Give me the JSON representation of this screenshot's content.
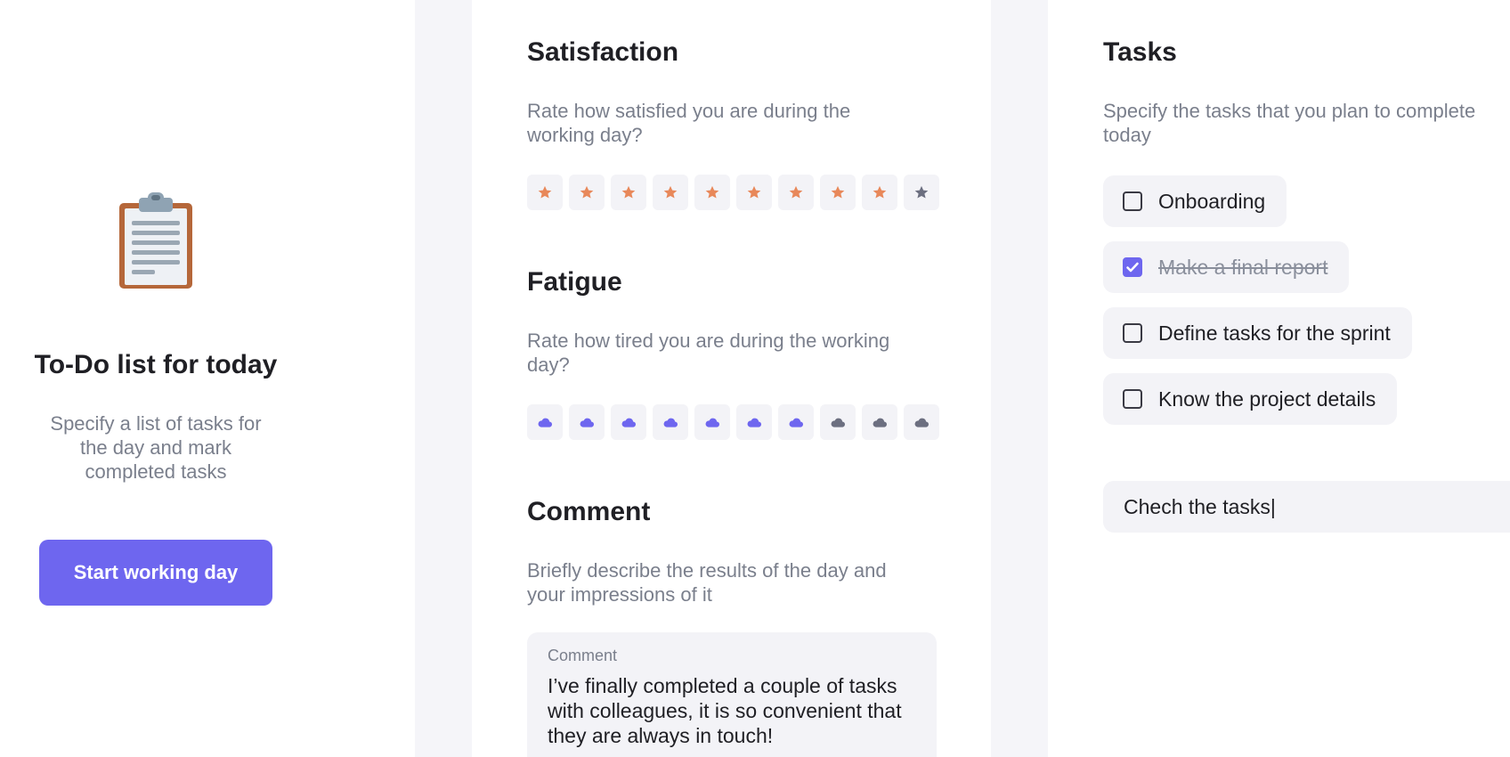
{
  "intro": {
    "title": "To-Do list for today",
    "subtitle": "Specify a list of tasks for the day and mark completed tasks",
    "start_button": "Start working day",
    "icon": "clipboard-icon"
  },
  "satisfaction": {
    "title": "Satisfaction",
    "description": "Rate how satisfied you are during the working day?",
    "icon": "star-icon",
    "max": 10,
    "value": 9,
    "active_color": "#e8885a",
    "inactive_color": "#6c6f80"
  },
  "fatigue": {
    "title": "Fatigue",
    "description": "Rate how tired you are during the working day?",
    "icon": "cloud-icon",
    "max": 10,
    "value": 7,
    "active_color": "#6e66ef",
    "inactive_color": "#6c6f80"
  },
  "comment": {
    "title": "Comment",
    "description": "Briefly describe the results of the day and your impressions of it",
    "field_label": "Comment",
    "value": "I’ve finally completed a couple of tasks with colleagues, it is so convenient that they are always in touch!"
  },
  "tasks": {
    "title": "Tasks",
    "description": "Specify the tasks that you plan to complete today",
    "items": [
      {
        "label": "Onboarding",
        "done": false
      },
      {
        "label": "Make a final report",
        "done": true
      },
      {
        "label": "Define tasks for the sprint",
        "done": false
      },
      {
        "label": "Know the project details",
        "done": false
      }
    ],
    "new_task_value": "Chech the tasks|"
  },
  "colors": {
    "accent": "#6e66ef",
    "field_bg": "#f3f3f7",
    "muted_text": "#7a7f8c"
  }
}
